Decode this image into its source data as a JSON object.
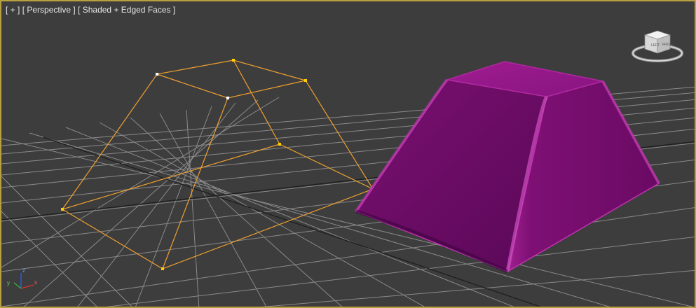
{
  "viewport": {
    "label_plus": "[ + ]",
    "label_view": "[ Perspective ]",
    "label_shading": "[ Shaded + Edged Faces ]",
    "border_color": "#b8a040",
    "background_color": "#3d3d3d"
  },
  "grid": {
    "line_color": "#8a8a8a",
    "axis_line_color": "#1a1a1a"
  },
  "wire_object": {
    "name": "pyramid-wireframe",
    "color": "#f0a030",
    "vertex_color": "#ffd000"
  },
  "solid_object": {
    "name": "truncated-pyramid",
    "color": "#8a1a7a"
  },
  "viewcube": {
    "icon": "viewcube-icon"
  },
  "axis_tripod": {
    "x_label": "x",
    "y_label": "y",
    "z_label": "z"
  }
}
